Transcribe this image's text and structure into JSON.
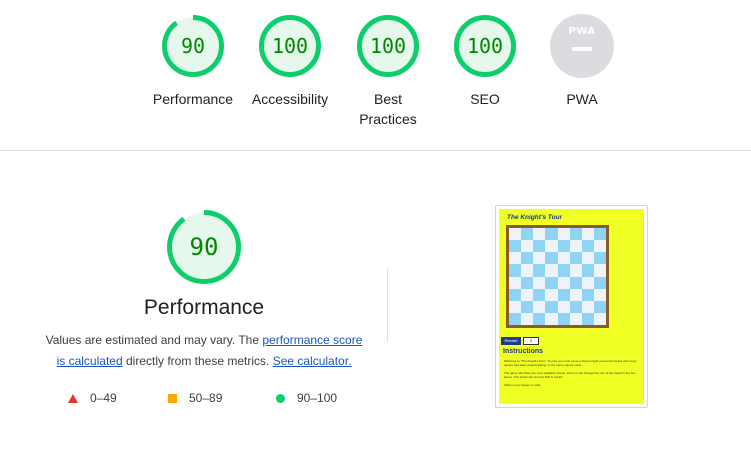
{
  "categories": [
    {
      "label": "Performance",
      "score": 90,
      "score_text": "90"
    },
    {
      "label": "Accessibility",
      "score": 100,
      "score_text": "100"
    },
    {
      "label": "Best Practices",
      "score": 100,
      "score_text": "100"
    },
    {
      "label": "SEO",
      "score": 100,
      "score_text": "100"
    },
    {
      "label": "PWA",
      "badge_text": "PWA"
    }
  ],
  "detail": {
    "score": 90,
    "score_text": "90",
    "title": "Performance",
    "desc_prefix": "Values are estimated and may vary. The ",
    "link_score": "performance score is calculated",
    "desc_middle": " directly from these metrics. ",
    "link_calc": "See calculator.",
    "legend": [
      {
        "icon": "triangle-icon",
        "range": "0–49",
        "color": "#eb3323"
      },
      {
        "icon": "square-icon",
        "range": "50–89",
        "color": "#ffa400"
      },
      {
        "icon": "circle-icon",
        "range": "90–100",
        "color": "#0cce6b"
      }
    ]
  },
  "screenshot": {
    "title": "The Knight's Tour",
    "restart_label": "Restart",
    "counter_value": "0",
    "instructions_heading": "Instructions",
    "text_1": "Welcome to \"The Knight's Tour\". To play you must move a chess knight around the board until every square has been visited landing on the same square twice.",
    "text_2": "The game will show you your available moves, and you can change the size of the board in the box above. The board can be from 5x5 to 10x10.",
    "text_3": "Click on any square to start."
  },
  "colors": {
    "pass_green": "#0cce6b",
    "pass_text": "#008800",
    "ring_bg": "#e6f7ec",
    "link": "#1a56c5",
    "page_bg_preview": "#f0ff24"
  }
}
